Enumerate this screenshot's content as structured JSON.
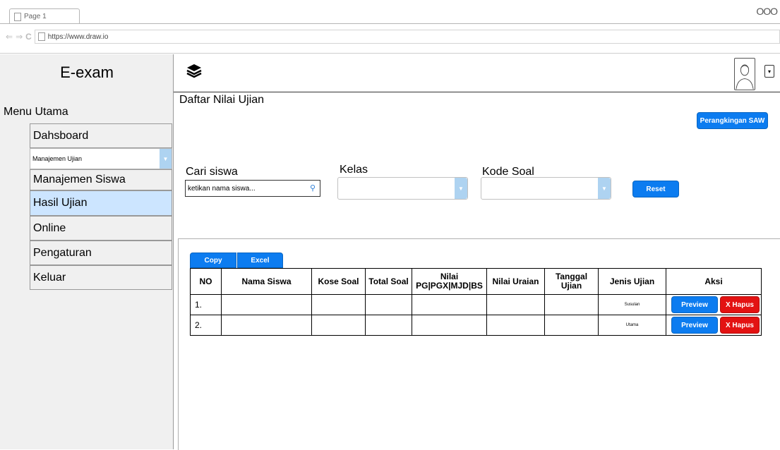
{
  "browser": {
    "tab_title": "Page 1",
    "url": "https://www.draw.io",
    "window_controls": "OOO"
  },
  "sidebar": {
    "brand": "E-exam",
    "menu_title": "Menu Utama",
    "items": [
      {
        "label": "Dahsboard",
        "active": false
      },
      {
        "label": "Manajemen Ujian",
        "type": "select"
      },
      {
        "label": "Manajemen Siswa",
        "active": false
      },
      {
        "label": "Hasil Ujian",
        "active": true
      },
      {
        "label": "Online",
        "active": false
      },
      {
        "label": "Pengaturan",
        "active": false
      },
      {
        "label": "Keluar",
        "active": false
      }
    ]
  },
  "header": {
    "logo_icon": "layers-icon",
    "avatar_icon": "user-avatar-icon",
    "dropdown_icon": "chevron-down-icon"
  },
  "page": {
    "title": "Daftar Nilai Ujian",
    "ranking_button": "Perangkingan SAW"
  },
  "filters": {
    "search_label": "Cari siswa",
    "search_placeholder": "ketikan nama siswa...",
    "kelas_label": "Kelas",
    "kode_label": "Kode Soal",
    "reset_button": "Reset"
  },
  "export": {
    "copy": "Copy",
    "excel": "Excel"
  },
  "table": {
    "headers": [
      "NO",
      "Nama Siswa",
      "Kose Soal",
      "Total Soal",
      "Nilai PG|PGX|MJD|BS",
      "Nilai Uraian",
      "Tanggal Ujian",
      "Jenis Ujian",
      "Aksi"
    ],
    "rows": [
      {
        "no": "1.",
        "nama": "",
        "kode": "",
        "total": "",
        "nilai": "",
        "uraian": "",
        "tanggal": "",
        "jenis": "Susulan"
      },
      {
        "no": "2.",
        "nama": "",
        "kode": "",
        "total": "",
        "nilai": "",
        "uraian": "",
        "tanggal": "",
        "jenis": "Utama"
      }
    ],
    "preview_label": "Preview",
    "delete_label": "X Hapus"
  },
  "colors": {
    "primary": "#0c7cf0",
    "danger": "#e31212",
    "active_menu": "#cce5ff",
    "select_arrow": "#aed3f1"
  }
}
